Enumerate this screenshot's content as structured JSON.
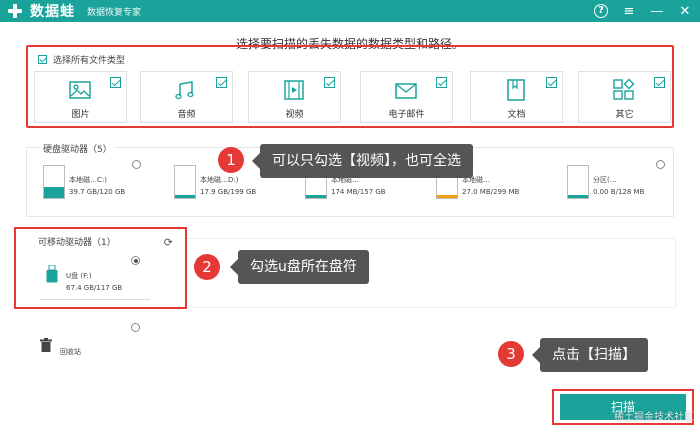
{
  "app": {
    "name": "数据蛙",
    "tagline": "数据恢复专家",
    "help_symbol": "?",
    "menu_symbol": "≡",
    "minimize_symbol": "—",
    "close_symbol": "✕"
  },
  "instruction": "选择要扫描的丢失数据的数据类型和路径。",
  "file_types": {
    "select_all_label": "选择所有文件类型",
    "items": [
      {
        "label": "图片",
        "icon": "image-icon"
      },
      {
        "label": "音频",
        "icon": "music-icon"
      },
      {
        "label": "视频",
        "icon": "video-icon"
      },
      {
        "label": "电子邮件",
        "icon": "email-icon"
      },
      {
        "label": "文档",
        "icon": "document-icon"
      },
      {
        "label": "其它",
        "icon": "other-icon"
      }
    ]
  },
  "hdd": {
    "title": "硬盘驱动器（5）",
    "drives": [
      {
        "name": "本地磁…C:)",
        "size": "39.7 GB/120 GB",
        "fill_color": "#1aa39b",
        "used_fraction": 0.33
      },
      {
        "name": "本地磁…D:)",
        "size": "17.9 GB/199 GB",
        "fill_color": "#1aa39b",
        "used_fraction": 0.09
      },
      {
        "name": "本地磁…",
        "size": "174 MB/157 GB",
        "fill_color": "#1aa39b",
        "used_fraction": 0.02
      },
      {
        "name": "本地磁…",
        "size": "27.0 MB/299 MB",
        "fill_color": "#f39c12",
        "used_fraction": 0.09
      },
      {
        "name": "分区(…",
        "size": "0.00  B/128 MB",
        "fill_color": "#1aa39b",
        "used_fraction": 0.0
      }
    ]
  },
  "removable": {
    "title": "可移动驱动器（1）",
    "drive_name": "U盘 (F:)",
    "drive_size": "67.4 GB/117 GB",
    "refresh_symbol": "⟳"
  },
  "recycle_label": "回收站",
  "tips": [
    {
      "num": "1",
      "text": "可以只勾选【视频】，也可全选"
    },
    {
      "num": "2",
      "text": "勾选u盘所在盘符"
    },
    {
      "num": "3",
      "text": "点击【扫描】"
    }
  ],
  "scan_label": "扫描",
  "watermark": "稀土掘金技术社区"
}
